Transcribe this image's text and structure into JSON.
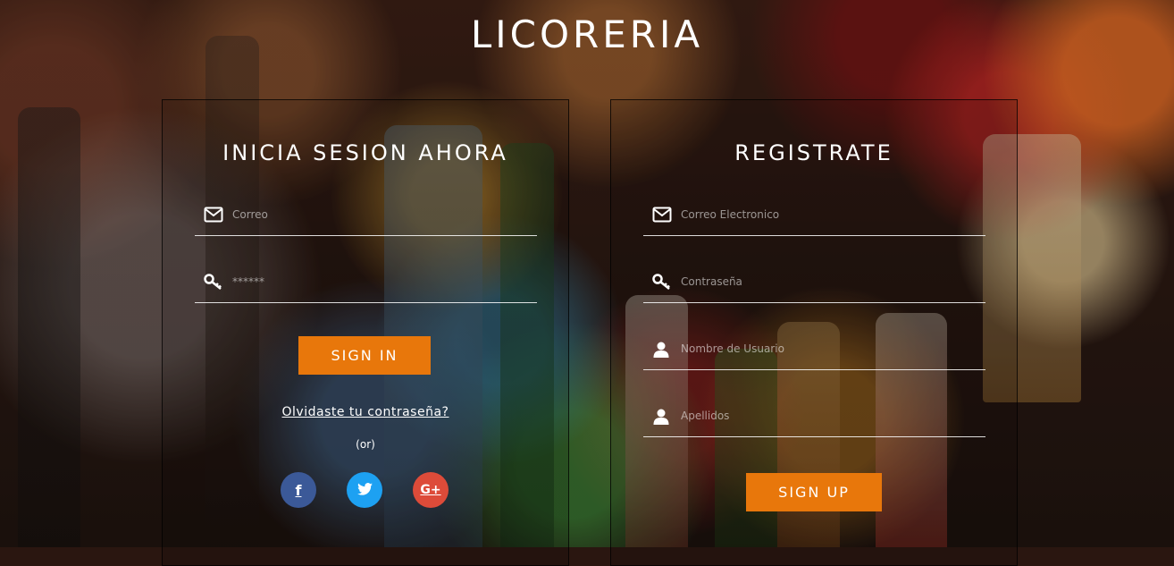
{
  "app": {
    "title": "LICORERIA"
  },
  "login": {
    "heading": "INICIA SESION AHORA",
    "email_placeholder": "Correo",
    "password_placeholder": "******",
    "submit_label": "SIGN IN",
    "forgot_label": "Olvidaste tu contraseña?",
    "or_label": "(or)",
    "social": [
      {
        "name": "facebook",
        "icon": "f",
        "color": "#3b5998"
      },
      {
        "name": "twitter",
        "icon": "twitter-bird-icon",
        "color": "#1da1f2"
      },
      {
        "name": "google-plus",
        "icon": "G+",
        "color": "#dd4b39"
      }
    ]
  },
  "register": {
    "heading": "REGISTRATE",
    "email_placeholder": "Correo Electronico",
    "password_placeholder": "Contraseña",
    "username_placeholder": "Nombre de Usuario",
    "lastname_placeholder": "Apellidos",
    "submit_label": "SIGN UP"
  },
  "colors": {
    "accent": "#e8770b"
  }
}
